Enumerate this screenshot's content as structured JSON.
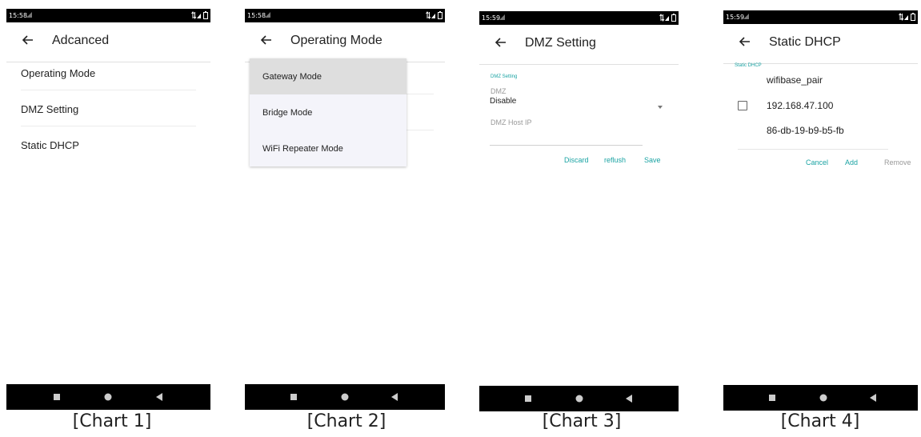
{
  "screens": [
    {
      "status_time": "15:58",
      "title": "Adcanced",
      "items": [
        "Operating Mode",
        "DMZ Setting",
        "Static DHCP"
      ],
      "caption": "[Chart 1]"
    },
    {
      "status_time": "15:58",
      "title": "Operating Mode",
      "options": [
        "Gateway Mode",
        "Bridge Mode",
        "WiFi Repeater Mode"
      ],
      "selected_option": "Gateway Mode",
      "caption": "[Chart 2]"
    },
    {
      "status_time": "15:59",
      "title": "DMZ Setting",
      "section_label": "DMZ Setting",
      "dmz_label": "DMZ",
      "dmz_value": "Disable",
      "host_ip_label": "DMZ Host IP",
      "buttons": {
        "discard": "Discard",
        "refresh": "reflush",
        "save": "Save"
      },
      "caption": "[Chart 3]"
    },
    {
      "status_time": "15:59",
      "title": "Static DHCP",
      "section_label": "Static DHCP",
      "entry": {
        "name": "wifibase_pair",
        "ip": "192.168.47.100",
        "mac": "86-db-19-b9-b5-fb"
      },
      "buttons": {
        "cancel": "Cancel",
        "add": "Add",
        "remove": "Remove"
      },
      "caption": "[Chart 4]"
    }
  ],
  "colors": {
    "accent": "#1aa3a3",
    "statusbar": "#000000",
    "navbar": "#000000",
    "selected_row": "#dedede",
    "popup_bg": "#f4f4fa"
  },
  "icons": {
    "back": "arrow-left-icon",
    "nav_recent": "square-icon",
    "nav_home": "circle-icon",
    "nav_back": "triangle-left-icon",
    "dropdown": "caret-down-icon"
  }
}
